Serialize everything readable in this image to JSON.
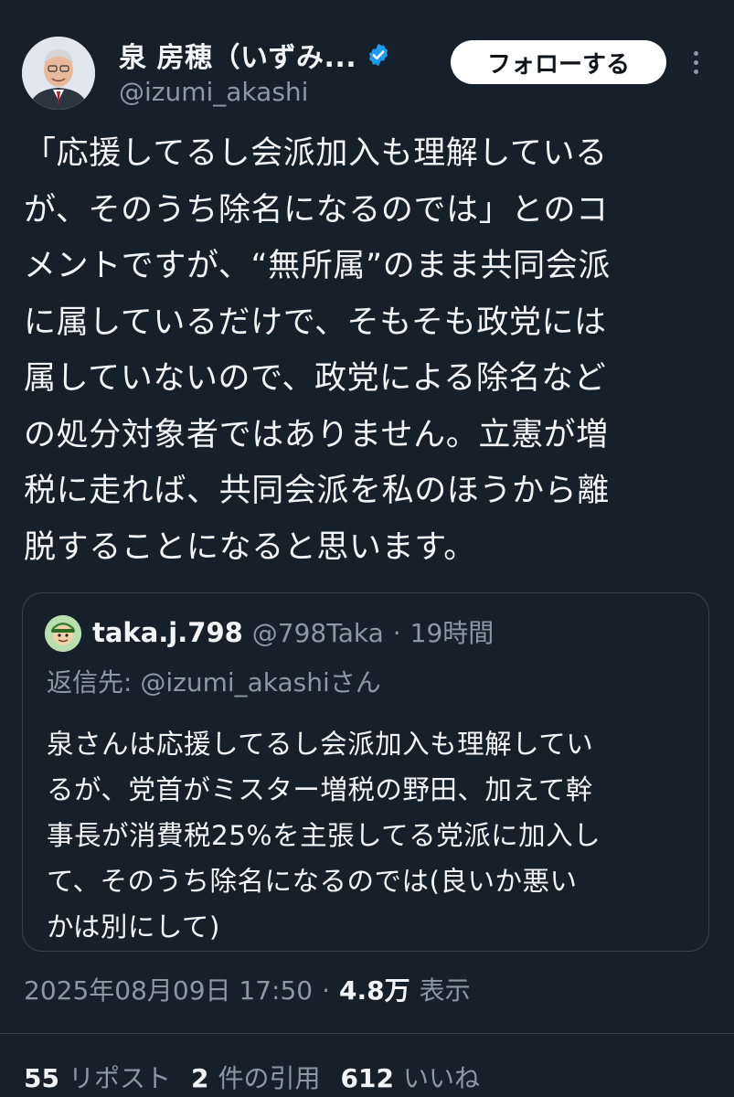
{
  "author": {
    "display_name": "泉 房穂（いずみ...",
    "handle": "@izumi_akashi",
    "verified": true
  },
  "header": {
    "follow_label": "フォローする"
  },
  "tweet": {
    "text": "「応援してるし会派加入も理解している\nが、そのうち除名になるのでは」とのコ\nメントですが、“無所属”のまま共同会派\nに属しているだけで、そもそも政党には\n属していないので、政党による除名など\nの処分対象者ではありません。立憲が増\n税に走れば、共同会派を私のほうから離\n脱することになると思います。"
  },
  "quote": {
    "name": "taka.j.798",
    "handle": "@798Taka",
    "separator": "·",
    "time": "19時間",
    "reply_prefix": "返信先: ",
    "reply_mention": "@izumi_akashi",
    "reply_suffix": "さん",
    "text": "泉さんは応援してるし会派加入も理解してい\nるが、党首がミスター増税の野田、加えて幹\n事長が消費税25%を主張してる党派に加入し\nて、そのうち除名になるのでは(良いか悪い\nかは別にして)"
  },
  "meta": {
    "timestamp": "2025年08月09日 17:50",
    "separator": "·",
    "views_count": "4.8万",
    "views_label": "表示"
  },
  "stats": {
    "reposts_count": "55",
    "reposts_label": "リポスト",
    "quotes_count": "2",
    "quotes_label": "件の引用",
    "likes_count": "612",
    "likes_label": "いいね"
  },
  "colors": {
    "background": "#15202b",
    "text_primary": "#e7e9ea",
    "text_secondary": "#8b98a5",
    "verified_badge": "#1d9bf0",
    "border": "#38444d"
  }
}
